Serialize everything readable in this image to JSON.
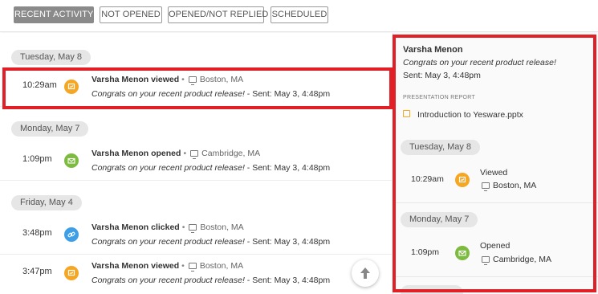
{
  "tabs": [
    {
      "label": "RECENT ACTIVITY",
      "active": true
    },
    {
      "label": "NOT OPENED",
      "active": false
    },
    {
      "label": "OPENED/NOT REPLIED",
      "active": false
    },
    {
      "label": "SCHEDULED",
      "active": false
    }
  ],
  "feed": {
    "days": [
      {
        "label": "Tuesday, May 8"
      },
      {
        "label": "Monday, May 7"
      },
      {
        "label": "Friday, May 4"
      }
    ],
    "events": [
      {
        "time": "10:29am",
        "actor_action": "Varsha Menon viewed",
        "location": "Boston, MA",
        "subject": "Congrats on your recent product release!",
        "sent": "- Sent: May 3, 4:48pm",
        "icon": "presentation-icon"
      },
      {
        "time": "1:09pm",
        "actor_action": "Varsha Menon opened",
        "location": "Cambridge, MA",
        "subject": "Congrats on your recent product release!",
        "sent": "- Sent: May 3, 4:48pm",
        "icon": "envelope-icon"
      },
      {
        "time": "3:48pm",
        "actor_action": "Varsha Menon clicked",
        "location": "Boston, MA",
        "subject": "Congrats on your recent product release!",
        "sent": "- Sent: May 3, 4:48pm",
        "icon": "link-icon"
      },
      {
        "time": "3:47pm",
        "actor_action": "Varsha Menon viewed",
        "location": "Boston, MA",
        "subject": "Congrats on your recent product release!",
        "sent": "- Sent: May 3, 4:48pm",
        "icon": "presentation-icon"
      }
    ],
    "bullet": "•"
  },
  "panel": {
    "name": "Varsha Menon",
    "subject": "Congrats on your recent product release!",
    "sent": "Sent: May 3, 4:48pm",
    "presentation_label": "PRESENTATION REPORT",
    "presentation_file": "Introduction to Yesware.pptx",
    "days": [
      {
        "label": "Tuesday, May 8",
        "time": "10:29am",
        "event": "Viewed",
        "location": "Boston, MA"
      },
      {
        "label": "Monday, May 7",
        "time": "1:09pm",
        "event": "Opened",
        "location": "Cambridge, MA"
      }
    ]
  },
  "colors": {
    "highlight": "#e01f26",
    "viewed": "#f5a623",
    "opened": "#7cbb3f",
    "clicked": "#3e9ee6",
    "active_tab": "#8a8a8a"
  }
}
